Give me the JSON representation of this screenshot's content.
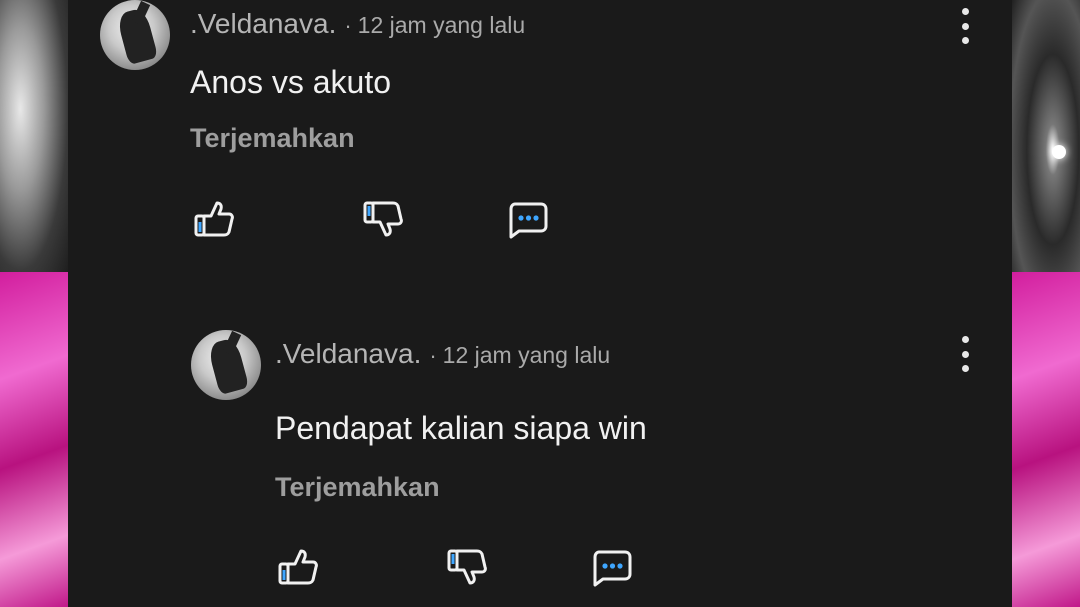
{
  "comments": [
    {
      "author": ".Veldanava.",
      "separator": "·",
      "time": "12 jam yang lalu",
      "text": "Anos vs akuto",
      "translate_label": "Terjemahkan"
    },
    {
      "author": ".Veldanava.",
      "separator": "·",
      "time": "12 jam yang lalu",
      "text": "Pendapat kalian siapa win",
      "translate_label": "Terjemahkan"
    }
  ],
  "icons": {
    "like": "thumbs-up-icon",
    "dislike": "thumbs-down-icon",
    "reply": "reply-comment-icon",
    "menu": "more-vertical-icon"
  },
  "colors": {
    "panel_bg": "#1a1a1a",
    "icon_accent": "#3ea6ff",
    "text": "#f1f1f1",
    "muted": "#aaaaaa"
  }
}
